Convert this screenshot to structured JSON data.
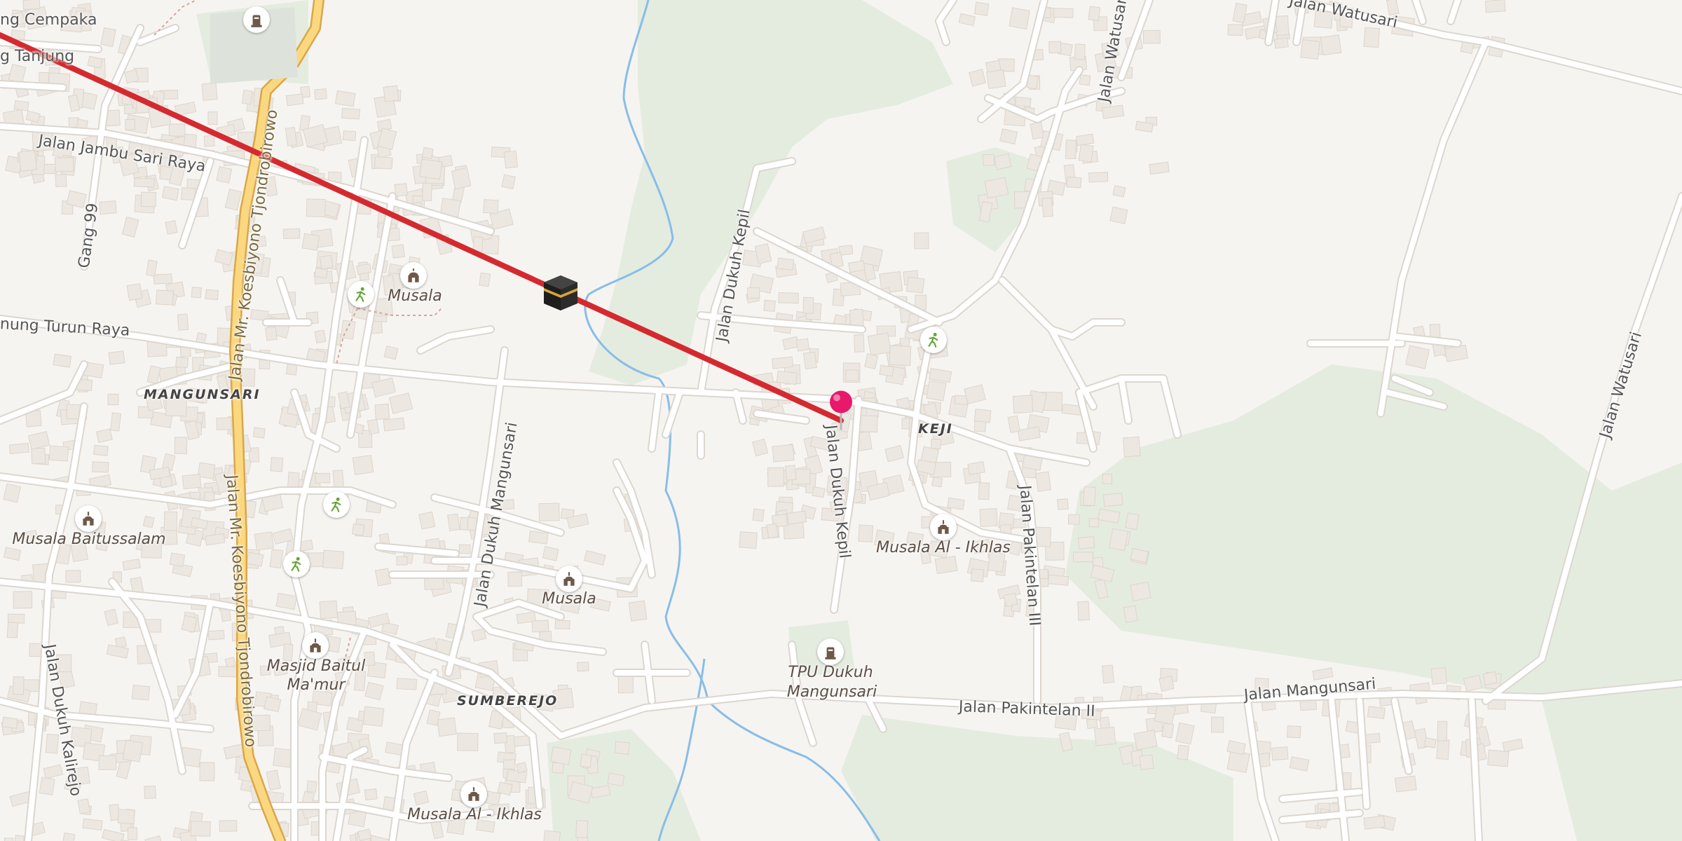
{
  "map": {
    "colors": {
      "land": "#f6f4f1",
      "park": "#e4ece0",
      "road": "#ffffff",
      "road_casing": "#dcd6cf",
      "main_road": "#fbd880",
      "main_road_casing": "#d9a74a",
      "river": "#88bde8",
      "building": "#ece7e1",
      "building_stroke": "#ddd5cc",
      "route_line": "#d42a2f",
      "pin": "#e8186b"
    },
    "roads": {
      "cempaka": "ng Cempaka",
      "tanjung": "g Tanjung",
      "jambu_sari_raya": "Jalan Jambu Sari Raya",
      "gang_99": "Gang 99",
      "koesbiyono_north": "Jalan Mr. Koesbiyono Tjondrobirowo",
      "koesbiyono_south": "Jalan Mr. Koesbiyono Tjondrobirowo",
      "turun_raya": "nung Turun Raya",
      "dukuh_kepil_north": "Jalan Dukuh Kepil",
      "dukuh_kepil_south": "Jalan Dukuh Kepil",
      "dukuh_mangunsari": "Jalan Dukuh Mangunsari",
      "dukuh_kalirejo": "Jalan Dukuh Kalirejo",
      "watusari_top": "Jalan Watusari",
      "watusari_right": "Jalan Watusari",
      "watusari_vertical": "Jalan Watusari",
      "pakintelan_iii": "Jalan Pakintelan III",
      "pakintelan_ii": "Jalan Pakintelan II",
      "mangunsari": "Jalan Mangunsari"
    },
    "places": {
      "mangunsari": "MANGUNSARI",
      "keji": "KEJI",
      "sumberejo": "SUMBEREJO"
    },
    "pois": {
      "musala_1": "Musala",
      "musala_baitussalam": "Musala Baitussalam",
      "musala_2": "Musala",
      "musala_al_ikhlas_1": "Musala Al - Ikhlas",
      "masjid_baitul_mamur_line1": "Masjid Baitul",
      "masjid_baitul_mamur_line2": "Ma'mur",
      "musala_al_ikhlas_2": "Musala Al - Ikhlas",
      "tpu_line1": "TPU Dukuh",
      "tpu_line2": "Mangunsari"
    },
    "icons": {
      "kaaba": "kaaba-icon",
      "pin": "location-pin-icon",
      "mosque": "mosque-icon",
      "cemetery": "cemetery-icon",
      "park": "playground-icon"
    }
  }
}
